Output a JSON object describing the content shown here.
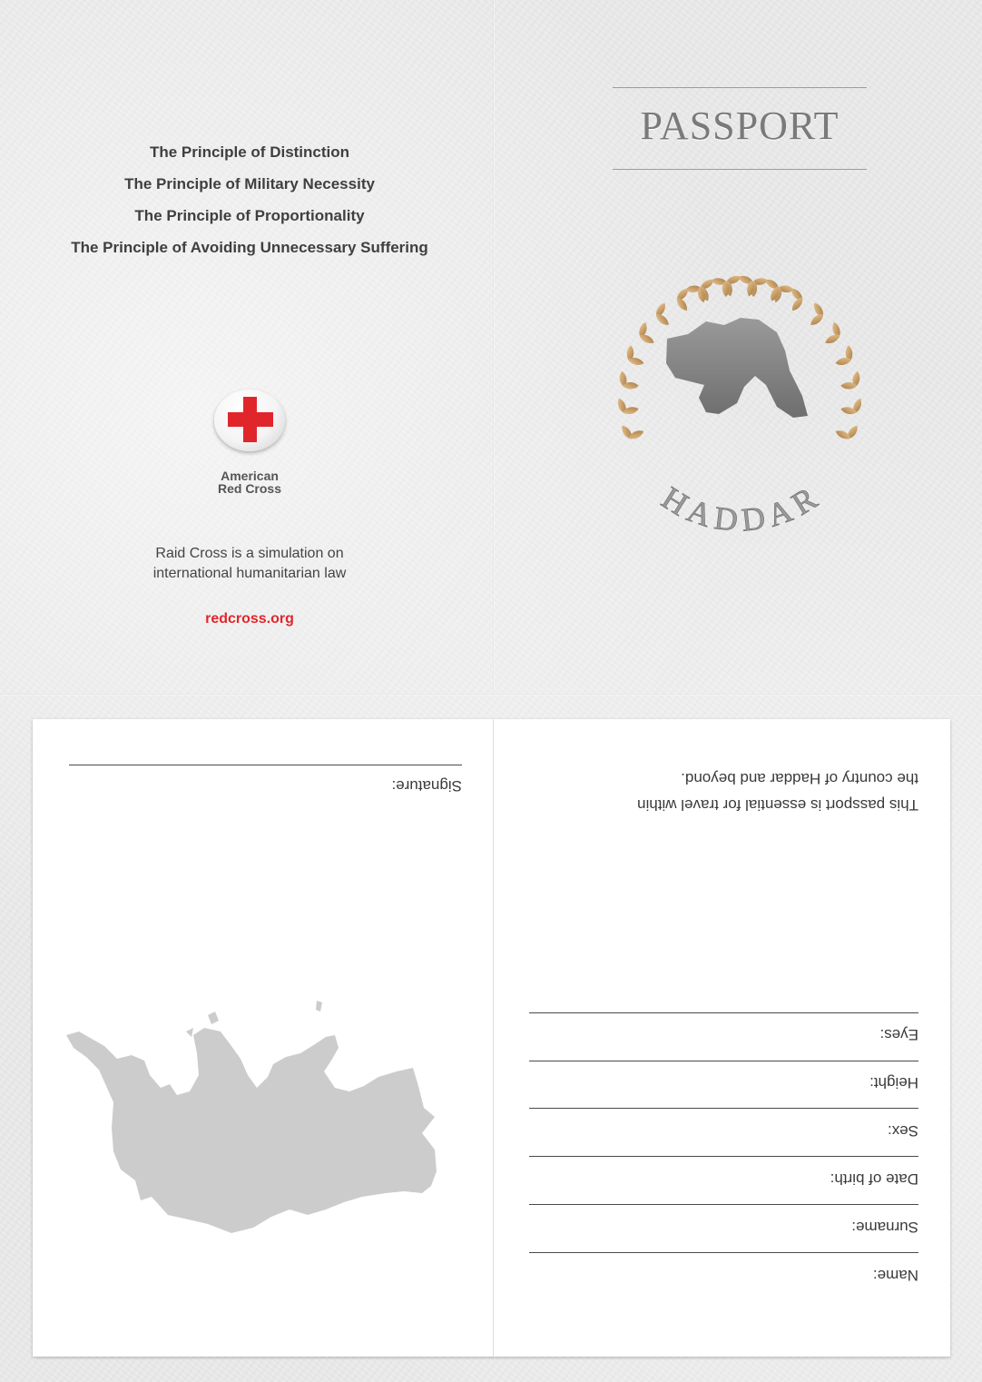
{
  "principles": [
    "The Principle of Distinction",
    "The Principle of Military Necessity",
    "The Principle of Proportionality",
    "The Principle of Avoiding Unnecessary Suffering"
  ],
  "logo": {
    "line1": "American",
    "line2": "Red Cross",
    "icon": "red-cross-emblem-icon",
    "color": "#e1262b"
  },
  "simulation": {
    "line1": "Raid Cross is a simulation on",
    "line2": "international humanitarian law"
  },
  "url": "redcross.org",
  "cover": {
    "title": "PASSPORT",
    "country": "HADDAR",
    "emblem_icon": "laurel-wreath-map-icon",
    "wreath_color": "#c9a06a"
  },
  "inner": {
    "signature_label": "Signature:",
    "intro_line1": "This passport is essential for travel within",
    "intro_line2": "the country of Haddar and beyond.",
    "fields": [
      "Name:",
      "Surname:",
      "Date of birth:",
      "Sex:",
      "Height:",
      "Eyes:"
    ],
    "map_icon": "haddar-map-icon"
  }
}
